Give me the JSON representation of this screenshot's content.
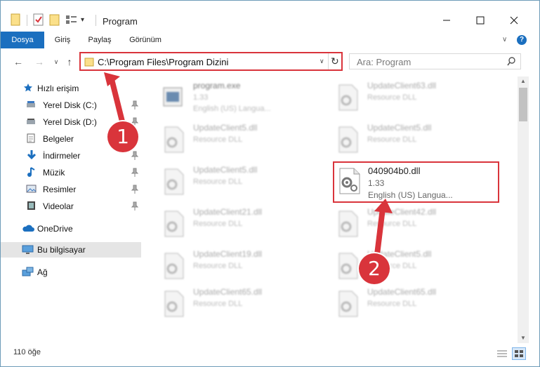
{
  "window": {
    "title": "Program"
  },
  "ribbon": {
    "tabs": [
      "Dosya",
      "Giriş",
      "Paylaş",
      "Görünüm"
    ]
  },
  "address": {
    "path": "C:\\Program Files\\Program Dizini"
  },
  "search": {
    "placeholder": "Ara: Program"
  },
  "sidebar": {
    "items": [
      {
        "label": "Hızlı erişim",
        "icon": "star-icon"
      },
      {
        "label": "Yerel Disk (C:)",
        "icon": "drive-icon",
        "pinned": true
      },
      {
        "label": "Yerel Disk (D:)",
        "icon": "drive-icon",
        "pinned": true
      },
      {
        "label": "Belgeler",
        "icon": "documents-icon",
        "pinned": true
      },
      {
        "label": "İndirmeler",
        "icon": "download-icon",
        "pinned": true
      },
      {
        "label": "Müzik",
        "icon": "music-icon",
        "pinned": true
      },
      {
        "label": "Resimler",
        "icon": "pictures-icon",
        "pinned": true
      },
      {
        "label": "Videolar",
        "icon": "videos-icon",
        "pinned": true
      },
      {
        "label": "OneDrive",
        "icon": "cloud-icon"
      },
      {
        "label": "Bu bilgisayar",
        "icon": "computer-icon"
      },
      {
        "label": "Ağ",
        "icon": "network-icon"
      }
    ]
  },
  "files": [
    {
      "name": "program.exe",
      "line2": "1.33",
      "line3": "English (US) Langua..."
    },
    {
      "name": "UpdateClient63.dll",
      "line2": "Resource DLL"
    },
    {
      "name": "UpdateClient5.dll",
      "line2": "Resource DLL"
    },
    {
      "name": "UpdateClient5.dll",
      "line2": "Resource DLL"
    },
    {
      "name": "UpdateClient5.dll",
      "line2": "Resource DLL"
    },
    {
      "name": "UpdateClient21.dll",
      "line2": "Resource DLL"
    },
    {
      "name": "UpdateClient42.dll",
      "line2": "Resource DLL"
    },
    {
      "name": "UpdateClient19.dll",
      "line2": "Resource DLL"
    },
    {
      "name": "UpdateClient5.dll",
      "line2": "Resource DLL"
    },
    {
      "name": "UpdateClient65.dll",
      "line2": "Resource DLL"
    },
    {
      "name": "UpdateClient65.dll",
      "line2": "Resource DLL"
    }
  ],
  "highlighted_file": {
    "name": "040904b0.dll",
    "line2": "1.33",
    "line3": "English (US) Langua..."
  },
  "annotations": {
    "badge1": "1",
    "badge2": "2"
  },
  "status": {
    "count": "110 öğe"
  },
  "colors": {
    "accent": "#1b6fbf",
    "highlight": "#d9343b"
  }
}
